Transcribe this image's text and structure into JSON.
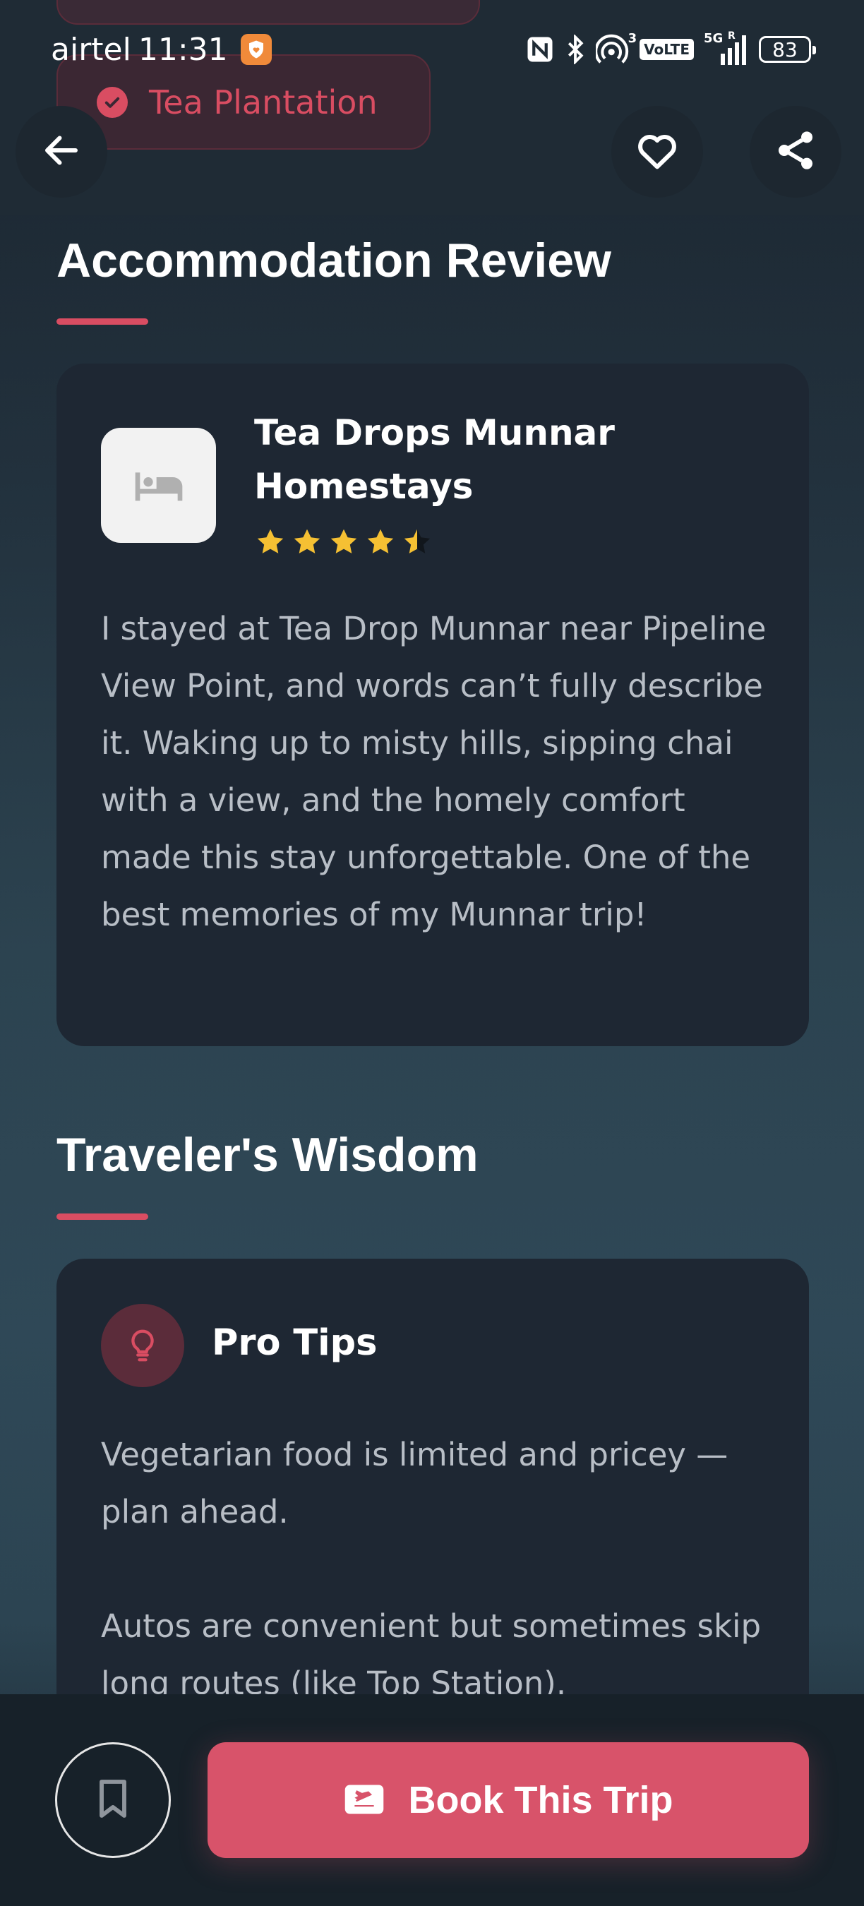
{
  "status_bar": {
    "carrier": "airtel",
    "time": "11:31",
    "network_badge": "VoLTE",
    "network_type": "5G",
    "roaming_mark": "R",
    "hotspot_count": "3",
    "battery": "83"
  },
  "header": {
    "chip_label": "Tea Plantation",
    "back_icon": "arrow-left-icon",
    "favorite_icon": "heart-icon",
    "share_icon": "share-icon"
  },
  "accommodation": {
    "section_title": "Accommodation Review",
    "hotel_name": "Tea Drops Munnar Homestays",
    "rating": 4.5,
    "rating_max": 5,
    "review": "I stayed at Tea Drop Munnar near Pipeline View Point, and words can’t fully describe it. Waking up to misty hills, sipping chai with a view, and the homely comfort made this stay unforgettable. One of the best memories of my Munnar trip!"
  },
  "wisdom": {
    "section_title": "Traveler's Wisdom",
    "tips_title": "Pro Tips",
    "tips": [
      "Vegetarian food is limited and pricey — plan ahead.",
      "Autos are convenient but sometimes skip long routes (like Top Station)."
    ]
  },
  "bottom_bar": {
    "book_label": "Book This Trip"
  },
  "colors": {
    "accent": "#d8536a",
    "star": "#f5c033",
    "card": "#1e2733"
  }
}
